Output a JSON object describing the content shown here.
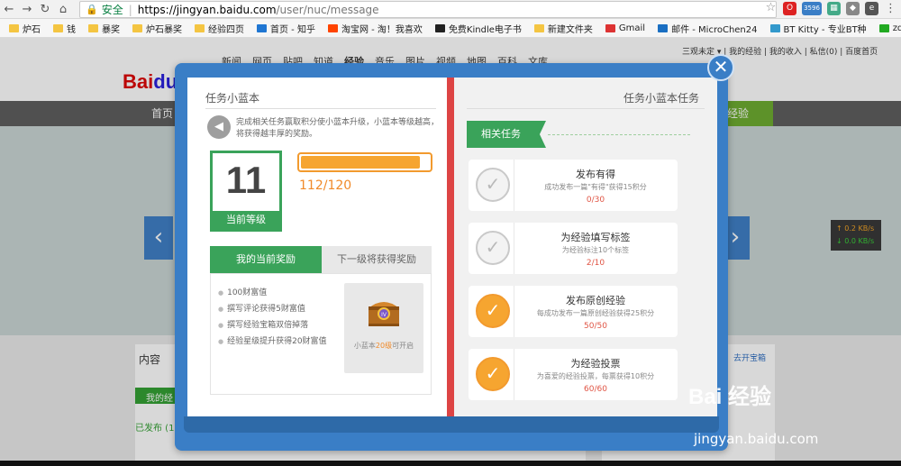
{
  "browser": {
    "back": "←",
    "forward": "→",
    "reload": "↻",
    "security_label": "安全",
    "url_host": "https://jingyan.baidu.com",
    "url_path": "/user/nuc/message",
    "badge_count": "3596"
  },
  "bookmarks": [
    "炉石",
    "钱",
    "暴奖",
    "炉石暴奖",
    "经验四页",
    "首页 - 知乎",
    "淘宝网 - 淘！我喜欢",
    "免费Kindle电子书",
    "新建文件夹",
    "Gmail",
    "邮件 - MicroChen24",
    "BT Kitty - 专业BT种",
    "zdfans"
  ],
  "background_page": {
    "logo": "Bai",
    "logo_tail": "du",
    "nav": [
      "新闻",
      "网页",
      "贴吧",
      "知道",
      "经验",
      "音乐",
      "图片",
      "视频",
      "地图",
      "百科",
      "文库"
    ],
    "user_links": "三观未定 ▾ | 我的经验 | 我的收入 | 私信(0) | 百度首页",
    "home_tab": "首页",
    "jingyan_tab": "经验",
    "content_title": "内容",
    "green_btn": "我的经",
    "published": "已发布 (1",
    "calendar_link": "去开宝箱",
    "net_up": "↑ 0.2 KB/s",
    "net_down": "↓ 0.0 KB/s",
    "prev_arrow": "‹",
    "next_arrow": "›"
  },
  "modal": {
    "close": "✕",
    "left_title": "任务小蓝本",
    "right_title": "任务小蓝本任务",
    "description": "完成相关任务赢取积分使小蓝本升级，小蓝本等级越高，将获得越丰厚的奖励。",
    "level": "11",
    "level_label": "当前等级",
    "progress_text": "112/120",
    "progress_fraction": 0.93,
    "tab_current": "我的当前奖励",
    "tab_next": "下一级将获得奖励",
    "rewards": [
      "100财富值",
      "撰写评论获得5财富值",
      "撰写经验宝箱双倍掉落",
      "经验星级提升获得20财富值"
    ],
    "chest_caption_pre": "小蓝本",
    "chest_caption_hl": "20级",
    "chest_caption_post": "可开启",
    "related_label": "相关任务",
    "tasks": [
      {
        "title": "发布有得",
        "sub": "成功发布一篇\"有得\"获得15积分",
        "progress": "0/30",
        "done": false
      },
      {
        "title": "为经验填写标签",
        "sub": "为经验标注10个标签",
        "progress": "2/10",
        "done": false
      },
      {
        "title": "发布原创经验",
        "sub": "每成功发布一篇原创经验获得25积分",
        "progress": "50/50",
        "done": true
      },
      {
        "title": "为经验投票",
        "sub": "为喜爱的经验投票，每票获得10积分",
        "progress": "60/60",
        "done": true
      }
    ]
  },
  "watermark": "Bai 经验",
  "watermark_url": "jingyan.baidu.com"
}
